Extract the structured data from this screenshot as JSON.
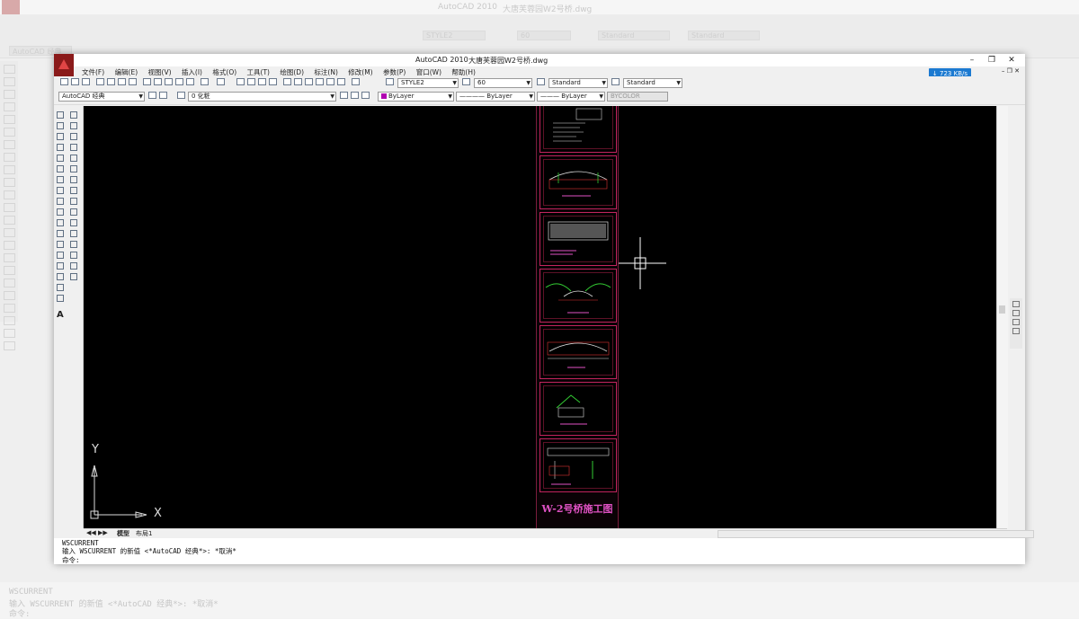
{
  "background_window": {
    "app_title": "AutoCAD 2010",
    "doc_title": "大唐芙蓉园W2号桥.dwg",
    "workspace": "AutoCAD 经典",
    "text_style": "STYLE2",
    "dim_scale": "60",
    "dim_style": "Standard",
    "table_style": "Standard",
    "cmd_line1": "WSCURRENT",
    "cmd_line2": "输入 WSCURRENT 的新值 <*AutoCAD 经典*>: *取消*",
    "cmd_line3": "命令:"
  },
  "window": {
    "app_title": "AutoCAD 2010",
    "doc_title": "大唐芙蓉园W2号桥.dwg",
    "controls": [
      "–",
      "❐",
      "✕"
    ]
  },
  "menu": {
    "items": [
      "文件(F)",
      "编辑(E)",
      "视图(V)",
      "插入(I)",
      "格式(O)",
      "工具(T)",
      "绘图(D)",
      "标注(N)",
      "修改(M)",
      "参数(P)",
      "窗口(W)",
      "帮助(H)"
    ],
    "doc_controls": "– ❐ ✕"
  },
  "network_badge": "↓ 723 KB/s",
  "styles_toolbar": {
    "text_style": "STYLE2",
    "dim_scale": "60",
    "dim_style": "Standard",
    "table_style": "Standard"
  },
  "layers_toolbar": {
    "workspace": "AutoCAD 经典",
    "layer": "0 化粧",
    "color": "ByLayer",
    "linetype": "ByLayer",
    "lineweight": "ByLayer",
    "plotstyle": "BYCOLOR"
  },
  "drawing": {
    "sheet_title": "W-2号桥施工图",
    "ucs_y": "Y",
    "ucs_x": "X",
    "colors": {
      "background": "#000000",
      "sheet_border": "#c2245e",
      "title": "#e052c4"
    }
  },
  "layout_tabs": [
    "模型",
    "布局1"
  ],
  "command_line": {
    "line1": "WSCURRENT",
    "line2": "输入 WSCURRENT 的新值 <*AutoCAD 经典*>: *取消*",
    "line3": "命令:"
  }
}
